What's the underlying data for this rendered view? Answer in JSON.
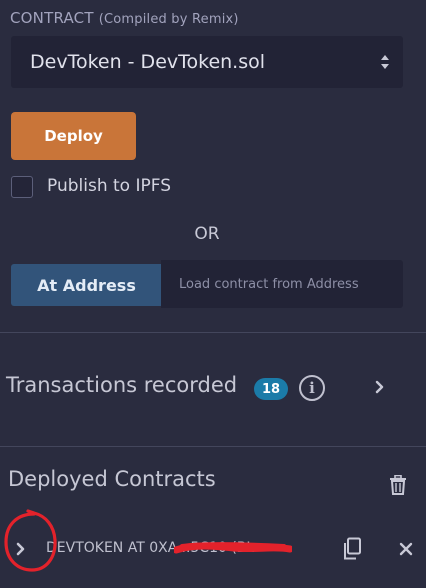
{
  "contract": {
    "label": "CONTRACT",
    "sublabel": "(Compiled by Remix)",
    "selected": "DevToken - DevToken.sol"
  },
  "deploy": {
    "button_label": "Deploy"
  },
  "publish": {
    "label": "Publish to IPFS",
    "checked": false
  },
  "or_text": "OR",
  "at_address": {
    "button_label": "At Address",
    "placeholder": "Load contract from Address"
  },
  "transactions": {
    "title": "Transactions recorded",
    "count": "18"
  },
  "deployed": {
    "title": "Deployed Contracts",
    "items": [
      {
        "label": "DEVTOKEN AT 0XA...5C10 (BL"
      }
    ]
  },
  "colors": {
    "background": "#2a2c3f",
    "deploy_button": "#c97539",
    "at_address_button": "#32547a",
    "badge": "#1b7ba8",
    "annotation_red": "#e3222b"
  },
  "icons": [
    "select-arrows-icon",
    "info-icon",
    "chevron-right-icon",
    "trash-icon",
    "copy-icon",
    "close-icon"
  ]
}
